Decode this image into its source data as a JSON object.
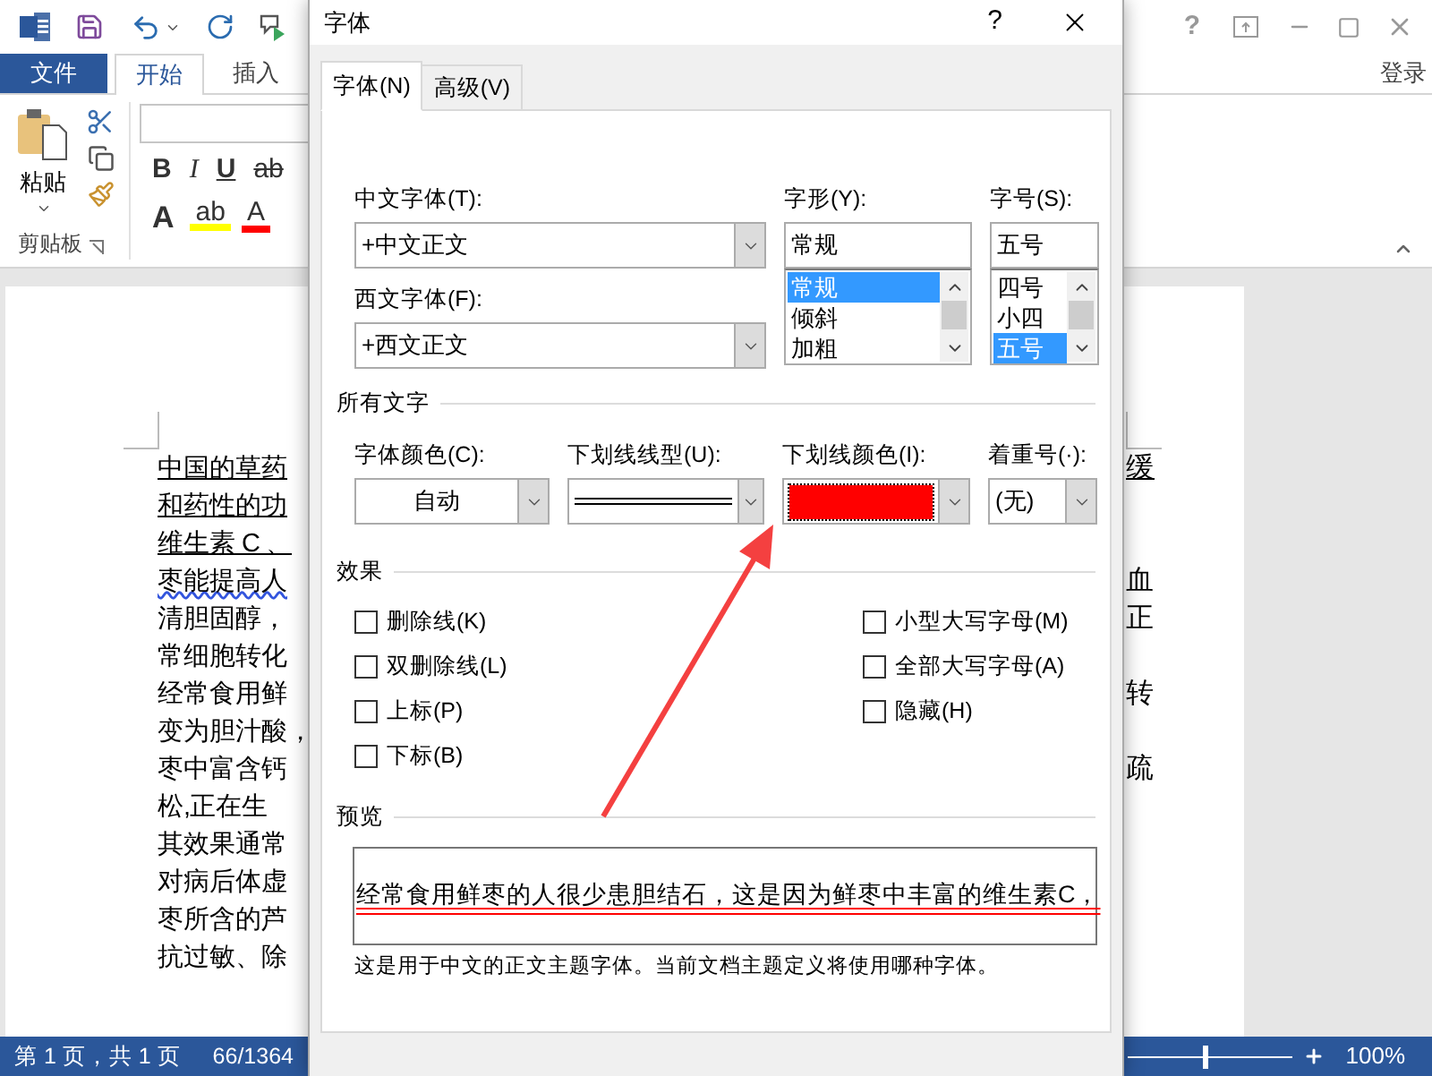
{
  "title_bar": {
    "help": "?"
  },
  "ribbon": {
    "tabs": [
      {
        "label": "文件",
        "kind": "file",
        "selected": false
      },
      {
        "label": "开始",
        "kind": "tab",
        "selected": true
      },
      {
        "label": "插入",
        "kind": "tab",
        "selected": false
      }
    ],
    "sign_in": "登录",
    "clipboard": {
      "paste": "粘贴",
      "group": "剪贴板"
    },
    "font_row1": [
      {
        "label": "B",
        "kind": "bold"
      },
      {
        "label": "I",
        "kind": "italic"
      },
      {
        "label": "U",
        "kind": "underline"
      },
      {
        "label": "ab",
        "kind": "strike"
      }
    ],
    "font_row2": [
      {
        "label": "A",
        "kind": "effects"
      },
      {
        "label": "ab",
        "kind": "highlight"
      },
      {
        "label": "A",
        "kind": "color"
      }
    ]
  },
  "document": {
    "lines": [
      {
        "left": "中国的草药",
        "right": "缓",
        "underlined": true
      },
      {
        "left": "和药性的功",
        "underlined": true
      },
      {
        "left": "维生素 C 、",
        "underlined": true
      },
      {
        "left": "枣能提高人",
        "right": "血",
        "underlined": false,
        "spelling_error": true
      },
      {
        "left": "清胆固醇，",
        "right": "正",
        "underlined": false,
        "spelling_error": false
      },
      {
        "left": "常细胞转化",
        "underlined": false,
        "spelling_error": false
      },
      {
        "left": "经常食用鲜",
        "right": "转",
        "underlined": false,
        "spelling_error": false
      },
      {
        "left": "变为胆汁酸，",
        "underlined": false,
        "spelling_error": false
      },
      {
        "left": "枣中富含钙",
        "right": "疏",
        "underlined": false,
        "spelling_error": false
      },
      {
        "left": "松,正在生",
        "underlined": false,
        "spelling_error": false
      },
      {
        "left": "其效果通常",
        "underlined": false,
        "spelling_error": false
      },
      {
        "left": "对病后体虚",
        "underlined": false,
        "spelling_error": false
      },
      {
        "left": "枣所含的芦",
        "underlined": false,
        "spelling_error": false
      },
      {
        "left": "抗过敏、除",
        "underlined": false,
        "spelling_error": false
      }
    ]
  },
  "status_bar": {
    "page": "第 1 页，共 1 页",
    "words": "66/1364",
    "zoom_slider": {
      "level": 0.47
    },
    "zoom": "100%"
  },
  "dialog": {
    "title": "字体",
    "help": "?",
    "tabs": [
      {
        "label": "字体(N)",
        "selected": true
      },
      {
        "label": "高级(V)",
        "selected": false
      }
    ],
    "chinese_font": {
      "label": "中文字体(T):",
      "value": "+中文正文"
    },
    "western_font": {
      "label": "西文字体(F):",
      "value": "+西文正文"
    },
    "style": {
      "label": "字形(Y):",
      "value": "常规",
      "options": [
        {
          "label": "常规",
          "selected": true
        },
        {
          "label": "倾斜",
          "selected": false
        },
        {
          "label": "加粗",
          "selected": false
        }
      ]
    },
    "size": {
      "label": "字号(S):",
      "value": "五号",
      "options": [
        {
          "label": "四号",
          "selected": false
        },
        {
          "label": "小四",
          "selected": false
        },
        {
          "label": "五号",
          "selected": true
        }
      ]
    },
    "all_text": {
      "heading": "所有文字",
      "font_color": {
        "label": "字体颜色(C):",
        "value": "自动"
      },
      "underline_style": {
        "label": "下划线线型(U):",
        "kind": "double"
      },
      "underline_color": {
        "label": "下划线颜色(I):",
        "color": "#ff0000"
      },
      "emphasis": {
        "label": "着重号(·):",
        "value": "(无)"
      }
    },
    "effects": {
      "heading": "效果",
      "left": [
        {
          "label": "删除线(K)",
          "checked": false
        },
        {
          "label": "双删除线(L)",
          "checked": false
        },
        {
          "label": "上标(P)",
          "checked": false
        },
        {
          "label": "下标(B)",
          "checked": false
        }
      ],
      "right": [
        {
          "label": "小型大写字母(M)",
          "checked": false
        },
        {
          "label": "全部大写字母(A)",
          "checked": false
        },
        {
          "label": "隐藏(H)",
          "checked": false
        }
      ]
    },
    "preview": {
      "heading": "预览",
      "text": "经常食用鲜枣的人很少患胆结石，这是因为鲜枣中丰富的维生素C，",
      "note": "这是用于中文的正文主题字体。当前文档主题定义将使用哪种字体。"
    }
  }
}
